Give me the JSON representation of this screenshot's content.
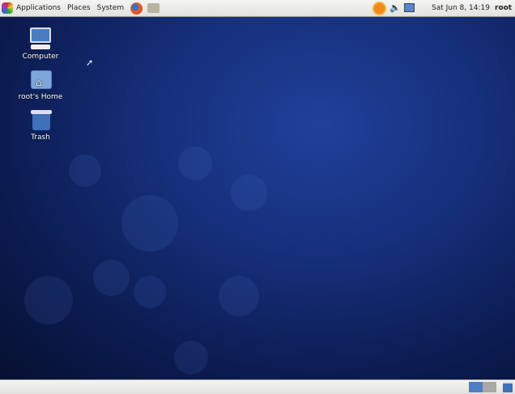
{
  "top_panel": {
    "menus": [
      "Applications",
      "Places",
      "System"
    ],
    "clock": "Sat Jun  8, 14:19",
    "user": "root"
  },
  "desktop": {
    "icons": [
      {
        "label": "Computer"
      },
      {
        "label": "root's Home"
      },
      {
        "label": "Trash"
      }
    ]
  },
  "colors": {
    "panel": "#e8e8e4",
    "desktop": "#16307c",
    "workspace_active": "#4f7fc0",
    "workspace_inactive": "#a8a8a4"
  }
}
